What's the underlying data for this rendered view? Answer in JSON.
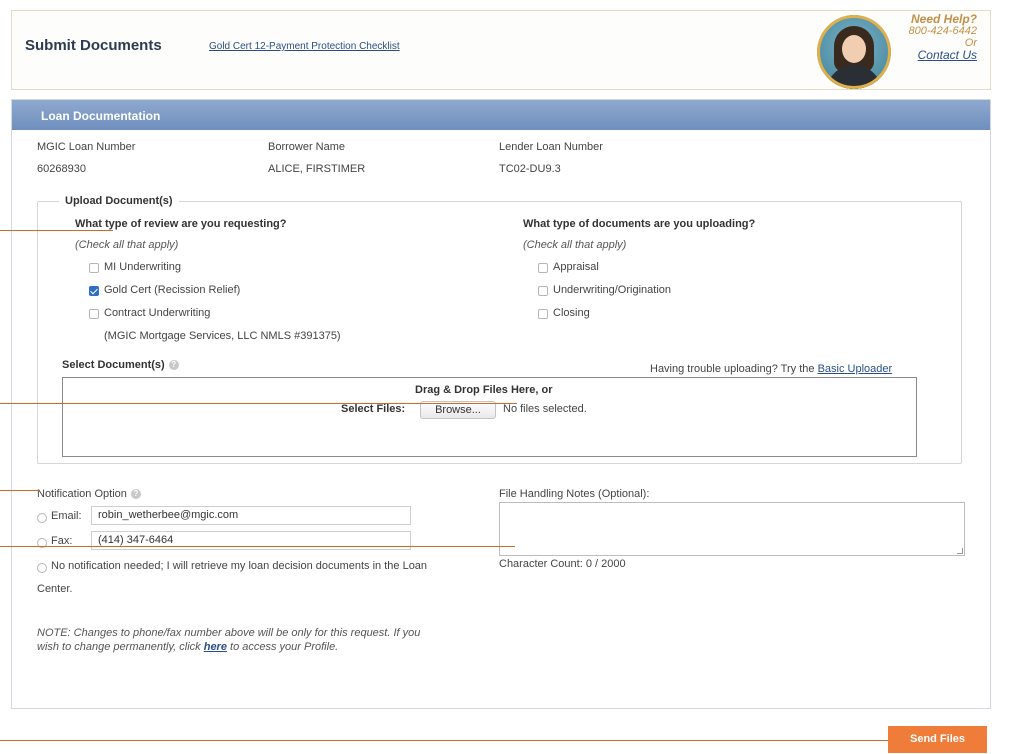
{
  "header": {
    "title": "Submit Documents",
    "checklist_link": "Gold Cert 12-Payment Protection Checklist",
    "help_title": "Need Help?",
    "help_phone": "800-424-6442",
    "help_or": "Or",
    "help_contact": "Contact Us"
  },
  "panel": {
    "title": "Loan Documentation",
    "loan_info": {
      "mgic_label": "MGIC Loan Number",
      "mgic_value": "60268930",
      "borrower_label": "Borrower Name",
      "borrower_value": "ALICE, FIRSTIMER",
      "lender_label": "Lender Loan Number",
      "lender_value": "TC02-DU9.3"
    }
  },
  "upload": {
    "legend": "Upload Document(s)",
    "review": {
      "question": "What type of review are you requesting?",
      "hint": "(Check all that apply)",
      "options": [
        {
          "label": "MI Underwriting",
          "checked": false
        },
        {
          "label": "Gold Cert (Recission Relief)",
          "checked": true
        },
        {
          "label": "Contract Underwriting",
          "checked": false
        }
      ],
      "note": "(MGIC Mortgage Services, LLC NMLS #391375)"
    },
    "docs": {
      "question": "What type of documents are you uploading?",
      "hint": "(Check all that apply)",
      "options": [
        {
          "label": "Appraisal",
          "checked": false
        },
        {
          "label": "Underwriting/Origination",
          "checked": false
        },
        {
          "label": "Closing",
          "checked": false
        }
      ]
    },
    "select_label": "Select Document(s)",
    "trouble_text": "Having trouble uploading? Try the",
    "basic_uploader": "Basic Uploader",
    "drop_text": "Drag & Drop Files Here, or",
    "select_files": "Select Files:",
    "browse_label": "Browse...",
    "no_files": "No files selected."
  },
  "notification": {
    "label": "Notification Option",
    "email_label": "Email:",
    "email_value": "robin_wetherbee@mgic.com",
    "fax_label": "Fax:",
    "fax_value": "(414) 347-6464",
    "none_line1": "No notification needed; I will retrieve my loan decision documents in the Loan",
    "none_line2": "Center.",
    "note_line1": "NOTE: Changes to phone/fax number above will be only for this request. If you",
    "note_pre": "wish to change permanently, click",
    "note_link": "here",
    "note_post": "to access your Profile."
  },
  "notes": {
    "label": "File Handling Notes (Optional):",
    "char_count": "Character Count: 0 / 2000"
  },
  "send_button": "Send Files",
  "colors": {
    "panel_bar": "#7f9cc8",
    "send_button": "#f07c3a",
    "annotation_line": "#cc6a2c",
    "link": "#2b4f88"
  }
}
